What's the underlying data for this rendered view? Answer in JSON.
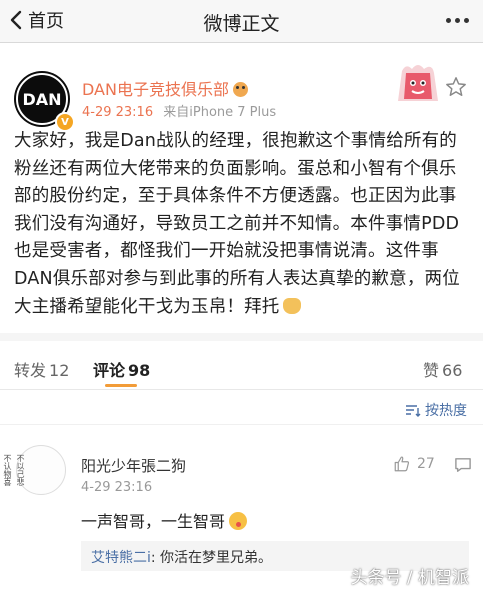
{
  "nav": {
    "back_label": "首页",
    "title": "微博正文"
  },
  "post": {
    "author": "DAN电子竞技俱乐部",
    "time": "4-29 23:16",
    "source": "来自iPhone 7 Plus",
    "avatar_text": "DAN",
    "content": "大家好，我是Dan战队的经理，很抱歉这个事情给所有的粉丝还有两位大佬带来的负面影响。蛋总和小智有个俱乐部的股份约定，至于具体条件不方便透露。也正因为此事我们没有沟通好，导致员工之前并不知情。本件事情PDD也是受害者，都怪我们一开始就没把事情说清。这件事DAN俱乐部对参与到此事的所有人表达真挚的歉意，两位大主播希望能化干戈为玉帛！拜托"
  },
  "tabs": {
    "repost_label": "转发",
    "repost_count": "12",
    "comment_label": "评论",
    "comment_count": "98",
    "like_label": "赞",
    "like_count": "66"
  },
  "sort": {
    "label": "按热度"
  },
  "comment": {
    "avatar_left": "不认物喜",
    "avatar_right": "不以己悲",
    "name": "阳光少年張二狗",
    "time": "4-29 23:16",
    "likes": "27",
    "text": "一声智哥，一生智哥",
    "reply_user": "艾特熊二i",
    "reply_text": ": 你活在梦里兄弟。"
  },
  "watermark": "头条号 / 机智派",
  "colors": {
    "accent": "#eb7350",
    "link": "#4a6fa5",
    "tab_underline": "#f29c38"
  }
}
